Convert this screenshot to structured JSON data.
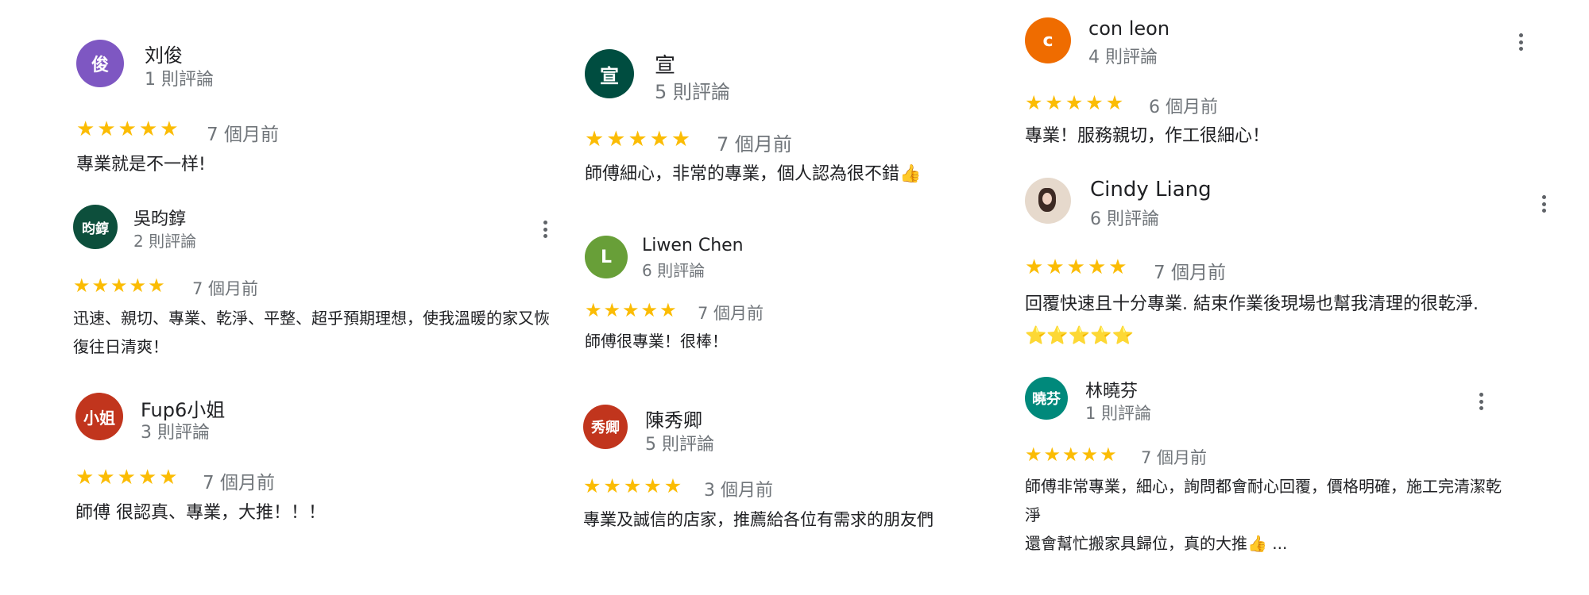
{
  "reviews": [
    {
      "name": "刘俊",
      "count": "1 則評論",
      "initial": "俊",
      "avatar_color": "#7e57c2",
      "stars": 5,
      "date": "7 個月前",
      "text": "專業就是不一样!",
      "has_menu": false
    },
    {
      "name": "吳昀錞",
      "count": "2 則評論",
      "initial": "昀錞",
      "avatar_color": "#0d4f3c",
      "stars": 5,
      "date": "7 個月前",
      "text": "迅速、親切、專業、乾淨、平整、超乎預期理想，使我溫暖的家又恢復往日清爽！",
      "has_menu": true
    },
    {
      "name": "Fup6小姐",
      "count": "3 則評論",
      "initial": "小姐",
      "avatar_color": "#c1351d",
      "stars": 5,
      "date": "7 個月前",
      "text": "師傅 很認真、專業，大推！！！",
      "has_menu": false
    },
    {
      "name": "宣",
      "count": "5 則評論",
      "initial": "宣",
      "avatar_color": "#004d40",
      "stars": 5,
      "date": "7 個月前",
      "text": "師傅細心，非常的專業，個人認為很不錯👍",
      "has_menu": false
    },
    {
      "name": "Liwen Chen",
      "count": "6 則評論",
      "initial": "L",
      "avatar_color": "#689f38",
      "stars": 5,
      "date": "7 個月前",
      "text": "師傅很專業！很棒！",
      "has_menu": false
    },
    {
      "name": "陳秀卿",
      "count": "5 則評論",
      "initial": "秀卿",
      "avatar_color": "#c1351d",
      "stars": 5,
      "date": "3 個月前",
      "text": "專業及誠信的店家，推薦給各位有需求的朋友們",
      "has_menu": false
    },
    {
      "name": "con leon",
      "count": "4 則評論",
      "initial": "c",
      "avatar_color": "#ef6c00",
      "stars": 5,
      "date": "6 個月前",
      "text": "專業！服務親切，作工很細心！",
      "has_menu": true
    },
    {
      "name": "Cindy Liang",
      "count": "6 則評論",
      "initial": "",
      "avatar_color": "#e6d9cc",
      "avatar_type": "photo",
      "stars": 5,
      "date": "7 個月前",
      "text": "回覆快速且十分專業. 結束作業後現場也幫我清理的很乾淨. ⭐⭐⭐⭐⭐",
      "has_menu": true
    },
    {
      "name": "林曉芬",
      "count": "1 則評論",
      "initial": "曉芬",
      "avatar_color": "#00897b",
      "stars": 5,
      "date": "7 個月前",
      "text": "師傅非常專業，細心，詢問都會耐心回覆，價格明確，施工完清潔乾淨\n還會幫忙搬家具歸位，真的大推👍 ...",
      "has_menu": true
    }
  ]
}
